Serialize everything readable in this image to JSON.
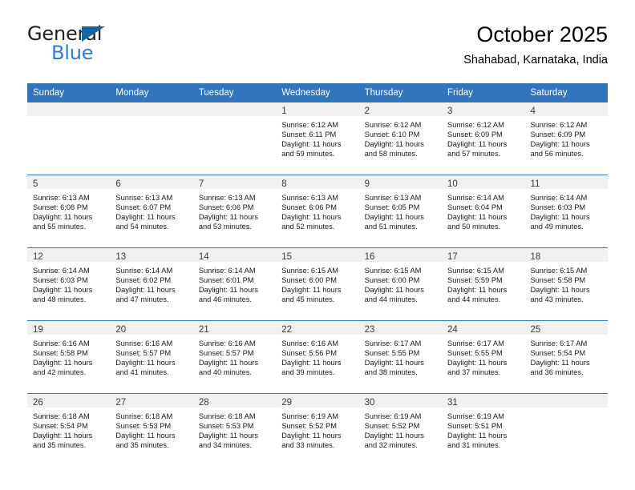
{
  "logo": {
    "word_one": "General",
    "word_two": "Blue",
    "triangle_icon": "triangle-icon",
    "brand_blue": "#2d7dd2",
    "triangle_color": "#1464aa"
  },
  "header": {
    "month_title": "October 2025",
    "location": "Shahabad, Karnataka, India"
  },
  "calendar": {
    "header_bg": "#3176bc",
    "daynum_bg": "#f1f1f1",
    "weekday_names": [
      "Sunday",
      "Monday",
      "Tuesday",
      "Wednesday",
      "Thursday",
      "Friday",
      "Saturday"
    ],
    "weeks": [
      [
        {
          "day": "",
          "lines": []
        },
        {
          "day": "",
          "lines": []
        },
        {
          "day": "",
          "lines": []
        },
        {
          "day": "1",
          "lines": [
            "Sunrise: 6:12 AM",
            "Sunset: 6:11 PM",
            "Daylight: 11 hours",
            "and 59 minutes."
          ]
        },
        {
          "day": "2",
          "lines": [
            "Sunrise: 6:12 AM",
            "Sunset: 6:10 PM",
            "Daylight: 11 hours",
            "and 58 minutes."
          ]
        },
        {
          "day": "3",
          "lines": [
            "Sunrise: 6:12 AM",
            "Sunset: 6:09 PM",
            "Daylight: 11 hours",
            "and 57 minutes."
          ]
        },
        {
          "day": "4",
          "lines": [
            "Sunrise: 6:12 AM",
            "Sunset: 6:09 PM",
            "Daylight: 11 hours",
            "and 56 minutes."
          ]
        }
      ],
      [
        {
          "day": "5",
          "lines": [
            "Sunrise: 6:13 AM",
            "Sunset: 6:08 PM",
            "Daylight: 11 hours",
            "and 55 minutes."
          ]
        },
        {
          "day": "6",
          "lines": [
            "Sunrise: 6:13 AM",
            "Sunset: 6:07 PM",
            "Daylight: 11 hours",
            "and 54 minutes."
          ]
        },
        {
          "day": "7",
          "lines": [
            "Sunrise: 6:13 AM",
            "Sunset: 6:06 PM",
            "Daylight: 11 hours",
            "and 53 minutes."
          ]
        },
        {
          "day": "8",
          "lines": [
            "Sunrise: 6:13 AM",
            "Sunset: 6:06 PM",
            "Daylight: 11 hours",
            "and 52 minutes."
          ]
        },
        {
          "day": "9",
          "lines": [
            "Sunrise: 6:13 AM",
            "Sunset: 6:05 PM",
            "Daylight: 11 hours",
            "and 51 minutes."
          ]
        },
        {
          "day": "10",
          "lines": [
            "Sunrise: 6:14 AM",
            "Sunset: 6:04 PM",
            "Daylight: 11 hours",
            "and 50 minutes."
          ]
        },
        {
          "day": "11",
          "lines": [
            "Sunrise: 6:14 AM",
            "Sunset: 6:03 PM",
            "Daylight: 11 hours",
            "and 49 minutes."
          ]
        }
      ],
      [
        {
          "day": "12",
          "lines": [
            "Sunrise: 6:14 AM",
            "Sunset: 6:03 PM",
            "Daylight: 11 hours",
            "and 48 minutes."
          ]
        },
        {
          "day": "13",
          "lines": [
            "Sunrise: 6:14 AM",
            "Sunset: 6:02 PM",
            "Daylight: 11 hours",
            "and 47 minutes."
          ]
        },
        {
          "day": "14",
          "lines": [
            "Sunrise: 6:14 AM",
            "Sunset: 6:01 PM",
            "Daylight: 11 hours",
            "and 46 minutes."
          ]
        },
        {
          "day": "15",
          "lines": [
            "Sunrise: 6:15 AM",
            "Sunset: 6:00 PM",
            "Daylight: 11 hours",
            "and 45 minutes."
          ]
        },
        {
          "day": "16",
          "lines": [
            "Sunrise: 6:15 AM",
            "Sunset: 6:00 PM",
            "Daylight: 11 hours",
            "and 44 minutes."
          ]
        },
        {
          "day": "17",
          "lines": [
            "Sunrise: 6:15 AM",
            "Sunset: 5:59 PM",
            "Daylight: 11 hours",
            "and 44 minutes."
          ]
        },
        {
          "day": "18",
          "lines": [
            "Sunrise: 6:15 AM",
            "Sunset: 5:58 PM",
            "Daylight: 11 hours",
            "and 43 minutes."
          ]
        }
      ],
      [
        {
          "day": "19",
          "lines": [
            "Sunrise: 6:16 AM",
            "Sunset: 5:58 PM",
            "Daylight: 11 hours",
            "and 42 minutes."
          ]
        },
        {
          "day": "20",
          "lines": [
            "Sunrise: 6:16 AM",
            "Sunset: 5:57 PM",
            "Daylight: 11 hours",
            "and 41 minutes."
          ]
        },
        {
          "day": "21",
          "lines": [
            "Sunrise: 6:16 AM",
            "Sunset: 5:57 PM",
            "Daylight: 11 hours",
            "and 40 minutes."
          ]
        },
        {
          "day": "22",
          "lines": [
            "Sunrise: 6:16 AM",
            "Sunset: 5:56 PM",
            "Daylight: 11 hours",
            "and 39 minutes."
          ]
        },
        {
          "day": "23",
          "lines": [
            "Sunrise: 6:17 AM",
            "Sunset: 5:55 PM",
            "Daylight: 11 hours",
            "and 38 minutes."
          ]
        },
        {
          "day": "24",
          "lines": [
            "Sunrise: 6:17 AM",
            "Sunset: 5:55 PM",
            "Daylight: 11 hours",
            "and 37 minutes."
          ]
        },
        {
          "day": "25",
          "lines": [
            "Sunrise: 6:17 AM",
            "Sunset: 5:54 PM",
            "Daylight: 11 hours",
            "and 36 minutes."
          ]
        }
      ],
      [
        {
          "day": "26",
          "lines": [
            "Sunrise: 6:18 AM",
            "Sunset: 5:54 PM",
            "Daylight: 11 hours",
            "and 35 minutes."
          ]
        },
        {
          "day": "27",
          "lines": [
            "Sunrise: 6:18 AM",
            "Sunset: 5:53 PM",
            "Daylight: 11 hours",
            "and 35 minutes."
          ]
        },
        {
          "day": "28",
          "lines": [
            "Sunrise: 6:18 AM",
            "Sunset: 5:53 PM",
            "Daylight: 11 hours",
            "and 34 minutes."
          ]
        },
        {
          "day": "29",
          "lines": [
            "Sunrise: 6:19 AM",
            "Sunset: 5:52 PM",
            "Daylight: 11 hours",
            "and 33 minutes."
          ]
        },
        {
          "day": "30",
          "lines": [
            "Sunrise: 6:19 AM",
            "Sunset: 5:52 PM",
            "Daylight: 11 hours",
            "and 32 minutes."
          ]
        },
        {
          "day": "31",
          "lines": [
            "Sunrise: 6:19 AM",
            "Sunset: 5:51 PM",
            "Daylight: 11 hours",
            "and 31 minutes."
          ]
        },
        {
          "day": "",
          "lines": []
        }
      ]
    ]
  }
}
